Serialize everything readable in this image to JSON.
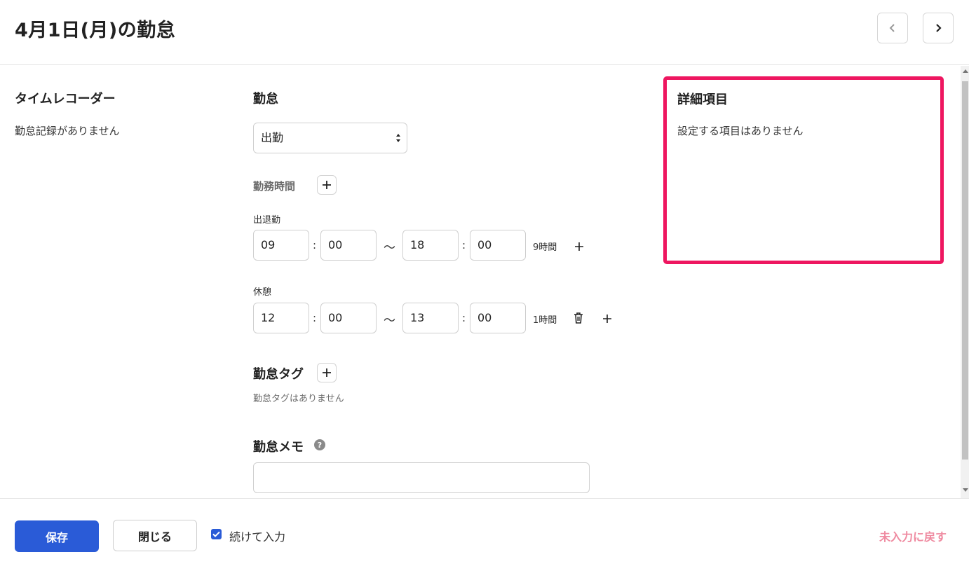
{
  "header": {
    "title": "4月1日(月)の勤怠",
    "prev_icon": "chevron-left-icon",
    "next_icon": "chevron-right-icon"
  },
  "time_recorder": {
    "heading": "タイムレコーダー",
    "empty_text": "勤怠記録がありません"
  },
  "attendance": {
    "heading": "勤怠",
    "type_value": "出勤",
    "work_time_heading": "勤務時間",
    "clock": {
      "label": "出退勤",
      "start_hour": "09",
      "start_min": "00",
      "end_hour": "18",
      "end_min": "00",
      "duration": "9時間"
    },
    "break": {
      "label": "休憩",
      "start_hour": "12",
      "start_min": "00",
      "end_hour": "13",
      "end_min": "00",
      "duration": "1時間"
    },
    "colon": ":",
    "tilde": "～",
    "tags_heading": "勤怠タグ",
    "tags_empty": "勤怠タグはありません",
    "memo_heading": "勤怠メモ",
    "memo_value": ""
  },
  "details": {
    "heading": "詳細項目",
    "empty_text": "設定する項目はありません"
  },
  "footer": {
    "save_label": "保存",
    "close_label": "閉じる",
    "continue_label": "続けて入力",
    "continue_checked": true,
    "revert_label": "未入力に戻す"
  },
  "colors": {
    "primary": "#2a5bd7",
    "highlight": "#ee1660",
    "revert": "#ef8aa0"
  }
}
